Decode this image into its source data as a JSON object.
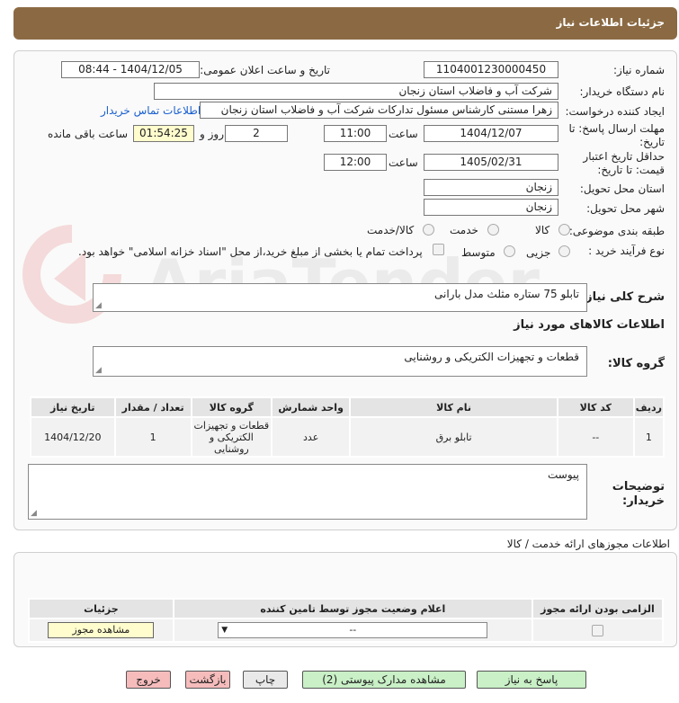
{
  "header": {
    "title": "جزئیات اطلاعات نیاز"
  },
  "form": {
    "need_number_label": "شماره نیاز:",
    "need_number": "1104001230000450",
    "announce_label": "تاریخ و ساعت اعلان عمومی:",
    "announce_value": "1404/12/05 - 08:44",
    "buyer_org_label": "نام دستگاه خریدار:",
    "buyer_org": "شرکت آب و فاضلاب استان زنجان",
    "creator_label": "ایجاد کننده درخواست:",
    "creator": "زهرا مستنی کارشناس مسئول تدارکات شرکت آب و فاضلاب استان زنجان",
    "contact_link": "اطلاعات تماس خریدار",
    "deadline_label_1": "مهلت ارسال پاسخ: تا",
    "deadline_label_2": "تاریخ:",
    "deadline_date": "1404/12/07",
    "time_label": "ساعت",
    "deadline_time": "11:00",
    "days_value": "2",
    "days_label": "روز و",
    "remaining_time": "01:54:25",
    "remaining_label": "ساعت باقی مانده",
    "validity_label_1": "حداقل تاریخ اعتبار",
    "validity_label_2": "قیمت: تا تاریخ:",
    "validity_date": "1405/02/31",
    "validity_time": "12:00",
    "province_label": "استان محل تحویل:",
    "province": "زنجان",
    "city_label": "شهر محل تحویل:",
    "city": "زنجان",
    "category_label": "طبقه بندی موضوعی:",
    "category_options": [
      "کالا",
      "خدمت",
      "کالا/خدمت"
    ],
    "process_label": "نوع فرآیند خرید :",
    "process_options": [
      "جزیی",
      "متوسط"
    ],
    "payment_note": "پرداخت تمام یا بخشی از مبلغ خرید،از محل \"اسناد خزانه اسلامی\" خواهد بود."
  },
  "description": {
    "label": "شرح کلی نیاز:",
    "value": "تابلو 75 ستاره  مثلث مدل بارانی"
  },
  "goods_info": {
    "title": "اطلاعات کالاهای مورد نیاز",
    "group_label": "گروه کالا:",
    "group_value": "قطعات و تجهیزات الکتریکی و روشنایی",
    "columns": [
      "ردیف",
      "کد کالا",
      "نام کالا",
      "واحد شمارش",
      "گروه کالا",
      "تعداد / مقدار",
      "تاریخ نیاز"
    ],
    "rows": [
      {
        "index": "1",
        "code": "--",
        "name": "تابلو برق",
        "unit": "عدد",
        "group": "قطعات و تجهیزات الکتریکی و روشنایی",
        "qty": "1",
        "date": "1404/12/20"
      }
    ]
  },
  "buyer_notes": {
    "label_1": "توضیحات",
    "label_2": "خریدار:",
    "value": "پیوست"
  },
  "permits": {
    "title": "اطلاعات مجوزهای ارائه خدمت / کالا",
    "columns": [
      "الزامی بودن ارائه مجوز",
      "اعلام وضعیت مجوز توسط تامین کننده",
      "جزئیات"
    ],
    "select_value": "--",
    "view_button": "مشاهده مجوز"
  },
  "buttons": {
    "reply": "پاسخ به نیاز",
    "attachments": "مشاهده مدارک پیوستی (2)",
    "print": "چاپ",
    "back": "بازگشت",
    "exit": "خروج"
  },
  "watermark": {
    "text": "AriaTender.neT"
  },
  "colors": {
    "header": "#8b6a43",
    "link": "#1a5fd0",
    "green_button": "#c9f0c6",
    "red_button": "#f6bcbc",
    "remaining_bg": "#fffccd"
  }
}
